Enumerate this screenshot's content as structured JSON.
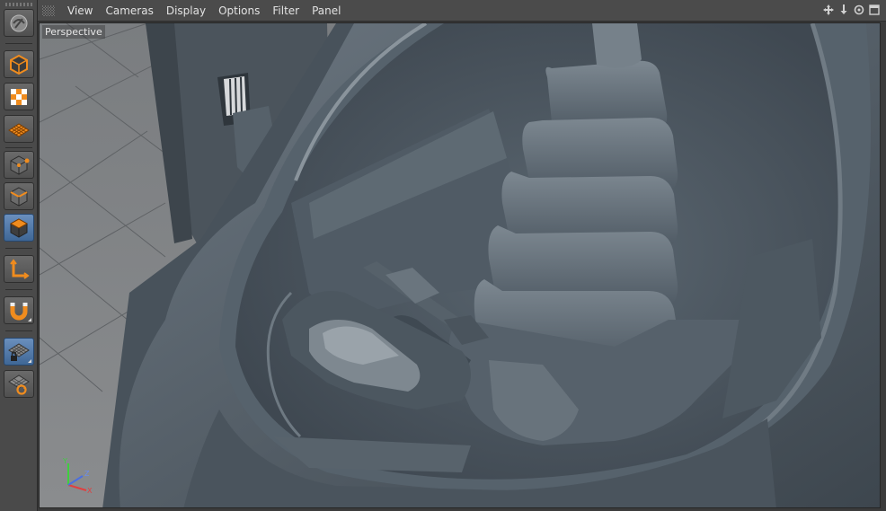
{
  "menubar": {
    "items": [
      "View",
      "Cameras",
      "Display",
      "Options",
      "Filter",
      "Panel"
    ]
  },
  "viewport": {
    "label": "Perspective",
    "axis_labels": {
      "x": "X",
      "y": "Y",
      "z": "Z"
    }
  },
  "palette": {
    "tools": [
      {
        "name": "undo-view-icon"
      },
      {
        "name": "model-mode-icon"
      },
      {
        "name": "texture-mode-icon"
      },
      {
        "name": "workplane-mode-icon"
      },
      {
        "name": "points-mode-icon"
      },
      {
        "name": "edges-mode-icon"
      },
      {
        "name": "polygons-mode-icon"
      },
      {
        "name": "axis-mode-icon"
      },
      {
        "name": "snap-magnet-icon"
      },
      {
        "name": "lock-workplane-icon"
      },
      {
        "name": "planar-workplane-icon"
      }
    ]
  },
  "view_controls": [
    "move-view-icon",
    "zoom-view-icon",
    "rotate-view-icon",
    "maximize-view-icon"
  ],
  "colors": {
    "accent_orange": "#f08c1e",
    "accent_blue": "#4f79ad",
    "model_gray": "#5f6b77"
  }
}
